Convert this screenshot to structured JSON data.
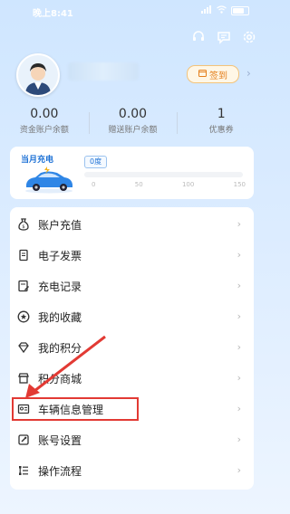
{
  "status_bar": {
    "time": "晚上8:41",
    "battery": "97"
  },
  "header": {
    "checkin_label": "签到"
  },
  "stats": [
    {
      "value": "0.00",
      "label": "资金账户余额"
    },
    {
      "value": "0.00",
      "label": "赠送账户余额"
    },
    {
      "value": "1",
      "label": "优惠券"
    }
  ],
  "charging": {
    "title": "当月充电",
    "tag": "0度",
    "ticks": [
      "0",
      "50",
      "100",
      "150"
    ]
  },
  "menu": {
    "items": [
      {
        "label": "账户充值",
        "icon": "moneybag-icon"
      },
      {
        "label": "电子发票",
        "icon": "invoice-icon"
      },
      {
        "label": "充电记录",
        "icon": "record-icon"
      },
      {
        "label": "我的收藏",
        "icon": "star-icon"
      },
      {
        "label": "我的积分",
        "icon": "diamond-icon"
      },
      {
        "label": "积分商城",
        "icon": "shop-icon"
      },
      {
        "label": "车辆信息管理",
        "icon": "vehicle-card-icon"
      },
      {
        "label": "账号设置",
        "icon": "settings-icon"
      },
      {
        "label": "操作流程",
        "icon": "flow-icon"
      }
    ]
  },
  "colors": {
    "accent": "#1e72d6",
    "highlight": "#e23a34",
    "checkin": "#e47f1c"
  }
}
